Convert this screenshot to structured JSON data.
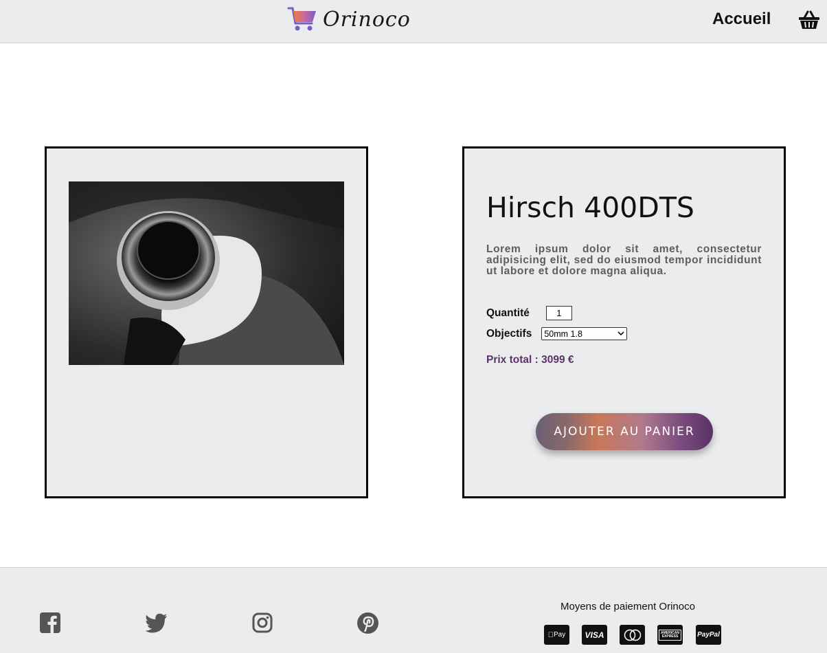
{
  "header": {
    "brand": "Orinoco",
    "home_link": "Accueil"
  },
  "product": {
    "name": "Hirsch 400DTS",
    "description": "Lorem ipsum dolor sit amet, consectetur adipisicing elit, sed do eiusmod tempor incididunt ut labore et dolore magna aliqua.",
    "quantity_label": "Quantité",
    "quantity_value": "1",
    "lens_label": "Objectifs",
    "lens_selected": "50mm 1.8",
    "total_price": "Prix total : 3099 €",
    "add_to_cart": "AJOUTER AU PANIER"
  },
  "footer": {
    "payment_title": "Moyens de paiement Orinoco",
    "social_icons": [
      "facebook-icon",
      "twitter-icon",
      "instagram-icon",
      "pinterest-icon"
    ],
    "payment_methods": [
      {
        "label": "Pay",
        "icon": "apple-pay-icon"
      },
      {
        "label": "VISA",
        "icon": "visa-icon"
      },
      {
        "label": "",
        "icon": "mastercard-icon"
      },
      {
        "label": "AMERICAN EXPRESS",
        "icon": "amex-icon"
      },
      {
        "label": "PayPal",
        "icon": "paypal-icon"
      }
    ]
  },
  "colors": {
    "background_panel": "#ebecee",
    "price_purple": "#5b3368",
    "desc_gray": "#5d5d5d"
  }
}
